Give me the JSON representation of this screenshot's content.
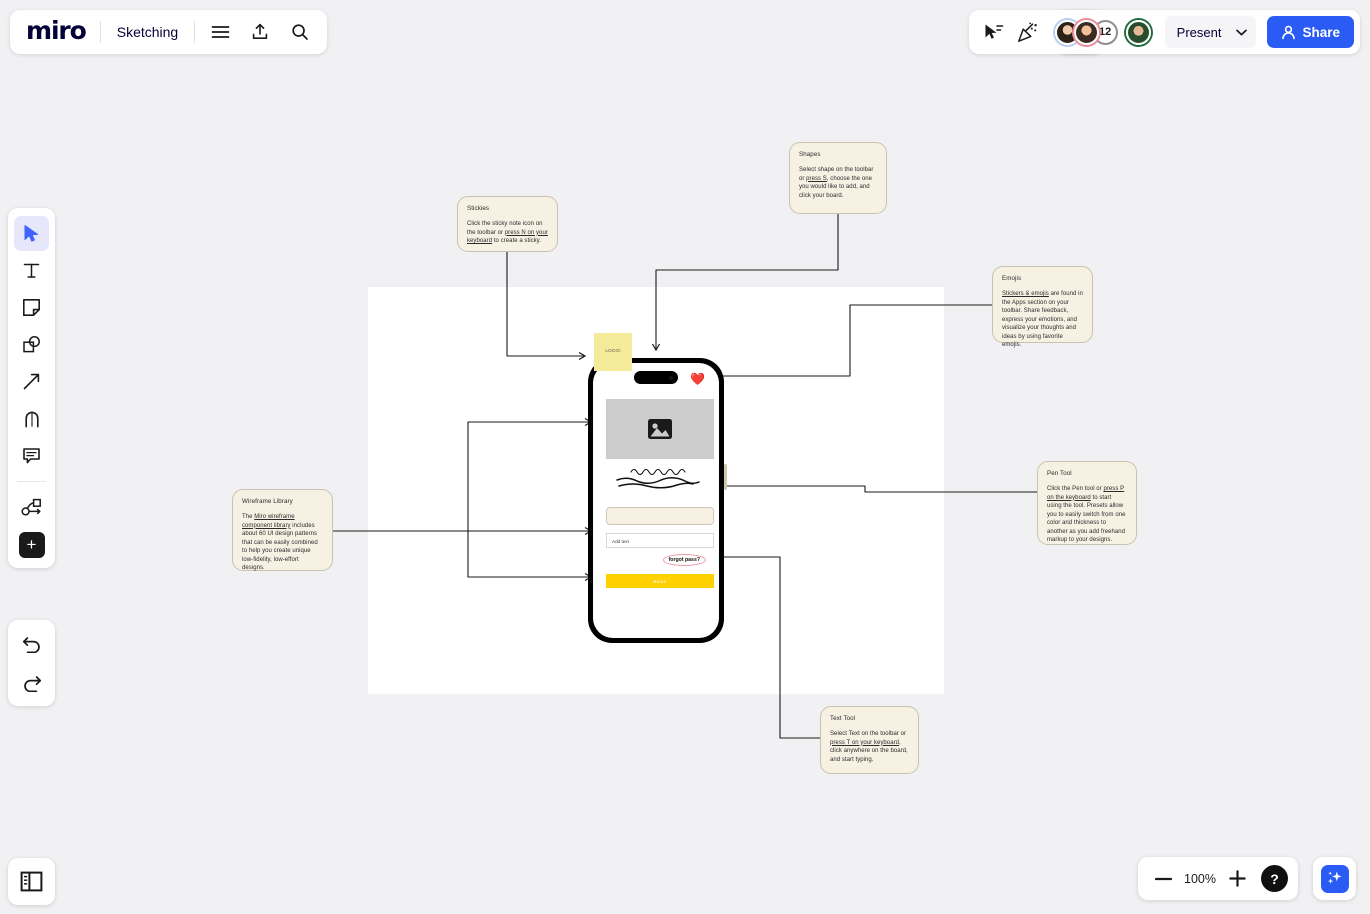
{
  "app": {
    "brand": "miro",
    "board_name": "Sketching"
  },
  "topbar": {
    "menu_icon": "hamburger-menu-icon",
    "upload_icon": "upload-icon",
    "search_icon": "search-icon",
    "shapes_panel_icon": "shapes-panel-icon",
    "cursor_icon": "cursor-share-icon",
    "reactions_icon": "party-popper-icon",
    "collaborator_count": "12",
    "present_label": "Present",
    "present_caret_icon": "chevron-down-icon",
    "share_label": "Share",
    "share_icon": "person-icon",
    "accent_blue": "#2a5bf5"
  },
  "left_toolbar": {
    "tools": [
      {
        "name": "select-tool",
        "icon": "cursor-arrow-icon",
        "active": true
      },
      {
        "name": "text-tool",
        "icon": "text-t-icon",
        "active": false
      },
      {
        "name": "sticky-note-tool",
        "icon": "sticky-note-icon",
        "active": false
      },
      {
        "name": "shapes-tool",
        "icon": "shapes-icon",
        "active": false
      },
      {
        "name": "connector-tool",
        "icon": "arrow-diagonal-icon",
        "active": false
      },
      {
        "name": "pen-tool",
        "icon": "pen-nib-icon",
        "active": false
      },
      {
        "name": "comment-tool",
        "icon": "comment-bubble-icon",
        "active": false
      },
      {
        "name": "frame-flow-tool",
        "icon": "flowchart-icon",
        "active": false
      },
      {
        "name": "more-apps-tool",
        "icon": "plus-icon",
        "active": false
      }
    ],
    "undo_icon": "undo-arrow-icon",
    "redo_icon": "redo-arrow-icon",
    "panel_icon": "side-panel-icon"
  },
  "zoom_bar": {
    "minus_icon": "minus-icon",
    "level": "100%",
    "plus_icon": "plus-icon",
    "help_label": "?",
    "ai_icon": "sparkles-icon"
  },
  "notes": {
    "stickies": {
      "title": "Stickies",
      "body_pre": "Click the sticky note icon on the toolbar or ",
      "body_link": "press N on your keyboard",
      "body_post": " to create a sticky."
    },
    "shapes": {
      "title": "Shapes",
      "body_pre": "Select shape on the toolbar or ",
      "body_link": "press S",
      "body_post": ", choose the one you would like to add, and click your board."
    },
    "emojis": {
      "title": "Emojis",
      "body_pre": "",
      "body_link": "Stickers & emojis",
      "body_post": " are found in the Apps section on your toolbar. Share feedback, express your emotions, and visualize your thoughts and ideas by using favorite emojis."
    },
    "pen": {
      "title": "Pen Tool",
      "body_pre": "Click the Pen tool or ",
      "body_link": "press P on the keyboard",
      "body_post": " to start using the tool. Presets allow you to easily switch from one color and thickness to another as you add freehand markup to your designs."
    },
    "wireframe": {
      "title": "Wireframe Library",
      "body_pre": "The ",
      "body_link": "Miro wireframe component library",
      "body_post": " includes about 60 UI design patterns that can be easily combined to help you create unique low-fidelity, low-effort designs."
    },
    "text": {
      "title": "Text Tool",
      "body_pre": "Select Text on the toolbar or ",
      "body_link": "press T on your keyboard",
      "body_post": ", click anywhere on the board, and start typing."
    },
    "sticky_bg": "#f7f1e3"
  },
  "phone": {
    "logo_label": "LOGO!",
    "heart_icon": "heart-emoji",
    "image_placeholder_icon": "image-placeholder-icon",
    "scribble_icon": "pen-scribble-marks",
    "input_placeholder": "Add text",
    "forgot_label": "forgot pass?",
    "button_label": "Buton",
    "button_color": "#ffd100",
    "logo_sticky_color": "#f5ea9a"
  },
  "canvas": {
    "background": "#f1f1f3",
    "frame_background": "#ffffff"
  }
}
